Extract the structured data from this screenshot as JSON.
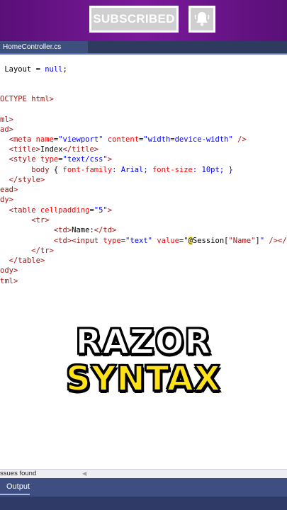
{
  "banner": {
    "subscribe_label": "SUBSCRIBED",
    "bell_icon": "bell-icon"
  },
  "editor": {
    "tab_label": "HomeController.cs",
    "code": {
      "l1_prefix": " Layout = ",
      "l1_kw": "null",
      "l1_end": ";",
      "l2": "OCTYPE html>",
      "l3": "ml>",
      "l4": "ad>",
      "l5_a": "<meta ",
      "l5_name_attr": "name",
      "l5_name_val": "\"viewport\"",
      "l5_content_attr": "content",
      "l5_content_val": "\"width=device-width\"",
      "l5_end": " />",
      "l6_open": "<title>",
      "l6_text": "Index",
      "l6_close": "</title>",
      "l7_a": "<style ",
      "l7_type_attr": "type",
      "l7_type_val": "\"text/css\"",
      "l7_end": ">",
      "l8_sel": "body",
      "l8_open": " { ",
      "l8_p1": "font-family",
      "l8_v1": ": Arial; ",
      "l8_p2": "font-size",
      "l8_v2": ": 10pt; }",
      "l9": "</style>",
      "l10": "ead>",
      "l11": "dy>",
      "l12_a": "<table ",
      "l12_attr": "cellpadding",
      "l12_val": "\"5\"",
      "l12_end": ">",
      "l13": "<tr>",
      "l14_open": "<td>",
      "l14_text": "Name:",
      "l14_close": "</td>",
      "l15_td": "<td>",
      "l15_input": "<input ",
      "l15_type_attr": "type",
      "l15_type_val": "\"text\"",
      "l15_value_attr": "value",
      "l15_q1": "\"",
      "l15_at": "@",
      "l15_session": "Session[",
      "l15_key": "\"Name\"",
      "l15_close_br": "]",
      "l15_q2": "\"",
      "l15_end": " /></",
      "l16": "</tr>",
      "l17": "</table>",
      "l18": "ody>",
      "l19": "tml>"
    }
  },
  "overlay": {
    "line1": "RAZOR",
    "line2": "SYNTAX"
  },
  "status": {
    "issues_text": "ssues found"
  },
  "output": {
    "label": "Output"
  },
  "colors": {
    "banner": "#6a1488",
    "tab_bg": "#3d4f7d",
    "keyword": "#0000ff",
    "attr": "#ff0000",
    "string": "#0000ff",
    "title_white": "#ffffff",
    "title_yellow": "#ffe21a"
  }
}
